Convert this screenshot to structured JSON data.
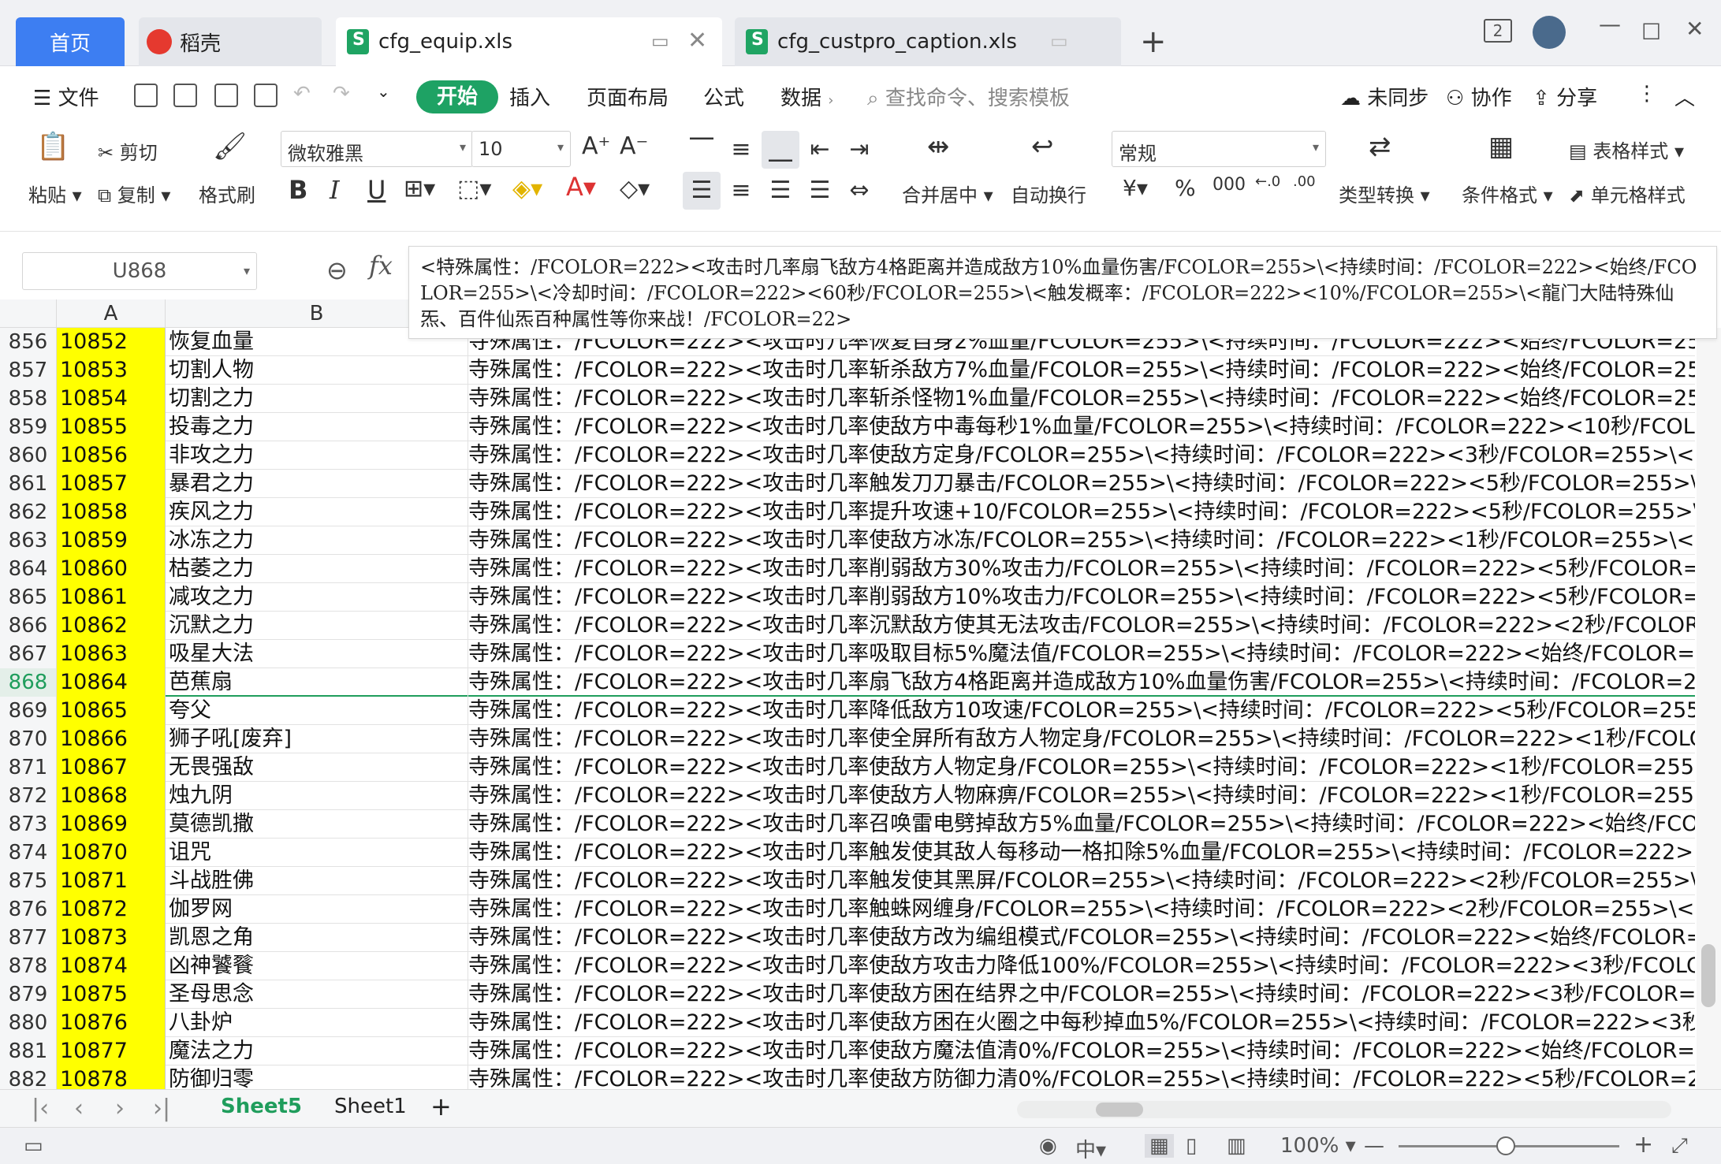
{
  "tabs": {
    "home": "首页",
    "docer": "稻壳",
    "file1": "cfg_equip.xls",
    "file2": "cfg_custpro_caption.xls",
    "new_tab": "+"
  },
  "window": {
    "page_indicator": "2"
  },
  "menu": {
    "file": "文件",
    "start": "开始",
    "insert": "插入",
    "page_layout": "页面布局",
    "formula": "公式",
    "data": "数据",
    "search_placeholder": "查找命令、搜索模板",
    "unsynced": "未同步",
    "collab": "协作",
    "share": "分享"
  },
  "ribbon": {
    "paste": "粘贴",
    "cut": "剪切",
    "copy": "复制",
    "format_painter": "格式刷",
    "font_name": "微软雅黑",
    "font_size": "10",
    "bold": "B",
    "italic": "I",
    "underline": "U",
    "merge_center": "合并居中",
    "wrap_text": "自动换行",
    "number_format": "常规",
    "percent": "%",
    "type_convert": "类型转换",
    "cond_format": "条件格式",
    "table_style": "表格样式",
    "cell_style": "单元格样式"
  },
  "formula_bar": {
    "cell_ref": "U868",
    "fx": "fx",
    "content": "<特殊属性：/FCOLOR=222><攻击时几率扇飞敌方4格距离并造成敌方10%血量伤害/FCOLOR=255>\\<持续时间：/FCOLOR=222><始终/FCOLOR=255>\\<冷却时间：/FCOLOR=222><60秒/FCOLOR=255>\\<触发概率：/FCOLOR=222><10%/FCOLOR=255>\\<龍门大陆特殊仙炁、百件仙炁百种属性等你来战！/FCOLOR=22>"
  },
  "columns": [
    "A",
    "B"
  ],
  "rows": [
    {
      "n": "856",
      "a": "10852",
      "b": "恢复血量",
      "c": "寺殊属性：/FCOLOR=222><攻击时几率恢复自身2%血量/FCOLOR=255>\\<持续时间：/FCOLOR=222><始终/FCOLOR=255>"
    },
    {
      "n": "857",
      "a": "10853",
      "b": "切割人物",
      "c": "寺殊属性：/FCOLOR=222><攻击时几率斩杀敌方7%血量/FCOLOR=255>\\<持续时间：/FCOLOR=222><始终/FCOLOR=255>"
    },
    {
      "n": "858",
      "a": "10854",
      "b": "切割之力",
      "c": "寺殊属性：/FCOLOR=222><攻击时几率斩杀怪物1%血量/FCOLOR=255>\\<持续时间：/FCOLOR=222><始终/FCOLOR=255>"
    },
    {
      "n": "859",
      "a": "10855",
      "b": "投毒之力",
      "c": "寺殊属性：/FCOLOR=222><攻击时几率使敌方中毒每秒1%血量/FCOLOR=255>\\<持续时间：/FCOLOR=222><10秒/FCOLOR"
    },
    {
      "n": "860",
      "a": "10856",
      "b": "非攻之力",
      "c": "寺殊属性：/FCOLOR=222><攻击时几率使敌方定身/FCOLOR=255>\\<持续时间：/FCOLOR=222><3秒/FCOLOR=255>\\<冷却"
    },
    {
      "n": "861",
      "a": "10857",
      "b": "暴君之力",
      "c": "寺殊属性：/FCOLOR=222><攻击时几率触发刀刀暴击/FCOLOR=255>\\<持续时间：/FCOLOR=222><5秒/FCOLOR=255>\\<冷"
    },
    {
      "n": "862",
      "a": "10858",
      "b": "疾风之力",
      "c": "寺殊属性：/FCOLOR=222><攻击时几率提升攻速+10/FCOLOR=255>\\<持续时间：/FCOLOR=222><5秒/FCOLOR=255>\\<冷"
    },
    {
      "n": "863",
      "a": "10859",
      "b": "冰冻之力",
      "c": "寺殊属性：/FCOLOR=222><攻击时几率使敌方冰冻/FCOLOR=255>\\<持续时间：/FCOLOR=222><1秒/FCOLOR=255>\\<冷却"
    },
    {
      "n": "864",
      "a": "10860",
      "b": "枯萎之力",
      "c": "寺殊属性：/FCOLOR=222><攻击时几率削弱敌方30%攻击力/FCOLOR=255>\\<持续时间：/FCOLOR=222><5秒/FCOLOR=25"
    },
    {
      "n": "865",
      "a": "10861",
      "b": "减攻之力",
      "c": "寺殊属性：/FCOLOR=222><攻击时几率削弱敌方10%攻击力/FCOLOR=255>\\<持续时间：/FCOLOR=222><5秒/FCOLOR=25"
    },
    {
      "n": "866",
      "a": "10862",
      "b": "沉默之力",
      "c": "寺殊属性：/FCOLOR=222><攻击时几率沉默敌方使其无法攻击/FCOLOR=255>\\<持续时间：/FCOLOR=222><2秒/FCOLOR=2"
    },
    {
      "n": "867",
      "a": "10863",
      "b": "吸星大法",
      "c": "寺殊属性：/FCOLOR=222><攻击时几率吸取目标5%魔法值/FCOLOR=255>\\<持续时间：/FCOLOR=222><始终/FCOLOR=25"
    },
    {
      "n": "868",
      "a": "10864",
      "b": "芭蕉扇",
      "c": "寺殊属性：/FCOLOR=222><攻击时几率扇飞敌方4格距离并造成敌方10%血量伤害/FCOLOR=255>\\<持续时间：/FCOLOR=222"
    },
    {
      "n": "869",
      "a": "10865",
      "b": "夸父",
      "c": "寺殊属性：/FCOLOR=222><攻击时几率降低敌方10攻速/FCOLOR=255>\\<持续时间：/FCOLOR=222><5秒/FCOLOR=255>\\<"
    },
    {
      "n": "870",
      "a": "10866",
      "b": "狮子吼[废弃]",
      "c": "寺殊属性：/FCOLOR=222><攻击时几率使全屏所有敌方人物定身/FCOLOR=255>\\<持续时间：/FCOLOR=222><1秒/FCOLOR"
    },
    {
      "n": "871",
      "a": "10867",
      "b": "无畏强敌",
      "c": "寺殊属性：/FCOLOR=222><攻击时几率使敌方人物定身/FCOLOR=255>\\<持续时间：/FCOLOR=222><1秒/FCOLOR=255>\\<冷"
    },
    {
      "n": "872",
      "a": "10868",
      "b": "烛九阴",
      "c": "寺殊属性：/FCOLOR=222><攻击时几率使敌方人物麻痹/FCOLOR=255>\\<持续时间：/FCOLOR=222><1秒/FCOLOR=255>\\<"
    },
    {
      "n": "873",
      "a": "10869",
      "b": "莫德凯撒",
      "c": "寺殊属性：/FCOLOR=222><攻击时几率召唤雷电劈掉敌方5%血量/FCOLOR=255>\\<持续时间：/FCOLOR=222><始终/FCOLC"
    },
    {
      "n": "874",
      "a": "10870",
      "b": "诅咒",
      "c": "寺殊属性：/FCOLOR=222><攻击时几率触发使其敌人每移动一格扣除5%血量/FCOLOR=255>\\<持续时间：/FCOLOR=222><5"
    },
    {
      "n": "875",
      "a": "10871",
      "b": "斗战胜佛",
      "c": "寺殊属性：/FCOLOR=222><攻击时几率触发使其黑屏/FCOLOR=255>\\<持续时间：/FCOLOR=222><2秒/FCOLOR=255>\\<冷"
    },
    {
      "n": "876",
      "a": "10872",
      "b": "伽罗网",
      "c": "寺殊属性：/FCOLOR=222><攻击时几率触蛛网缠身/FCOLOR=255>\\<持续时间：/FCOLOR=222><2秒/FCOLOR=255>\\<冷却"
    },
    {
      "n": "877",
      "a": "10873",
      "b": "凯恩之角",
      "c": "寺殊属性：/FCOLOR=222><攻击时几率使敌方改为编组模式/FCOLOR=255>\\<持续时间：/FCOLOR=222><始终/FCOLOR=25"
    },
    {
      "n": "878",
      "a": "10874",
      "b": "凶神饕餮",
      "c": "寺殊属性：/FCOLOR=222><攻击时几率使敌方攻击力降低100%/FCOLOR=255>\\<持续时间：/FCOLOR=222><3秒/FCOLOR="
    },
    {
      "n": "879",
      "a": "10875",
      "b": "圣母思念",
      "c": "寺殊属性：/FCOLOR=222><攻击时几率使敌方困在结界之中/FCOLOR=255>\\<持续时间：/FCOLOR=222><3秒/FCOLOR=25"
    },
    {
      "n": "880",
      "a": "10876",
      "b": "八卦炉",
      "c": "寺殊属性：/FCOLOR=222><攻击时几率使敌方困在火圈之中每秒掉血5%/FCOLOR=255>\\<持续时间：/FCOLOR=222><3秒/F"
    },
    {
      "n": "881",
      "a": "10877",
      "b": "魔法之力",
      "c": "寺殊属性：/FCOLOR=222><攻击时几率使敌方魔法值清0%/FCOLOR=255>\\<持续时间：/FCOLOR=222><始终/FCOLOR=25"
    },
    {
      "n": "882",
      "a": "10878",
      "b": "防御归零",
      "c": "寺殊属性：/FCOLOR=222><攻击时几率使敌方防御力清0%/FCOLOR=255>\\<持续时间：/FCOLOR=222><5秒/FCOLOR=255"
    }
  ],
  "selected_row": "868",
  "sheets": {
    "sheet5": "Sheet5",
    "sheet1": "Sheet1",
    "add": "+"
  },
  "status": {
    "zoom": "100%"
  },
  "colors": {
    "accent": "#1ea264",
    "home_tab": "#3d7ef2",
    "highlight": "#ffff00"
  }
}
